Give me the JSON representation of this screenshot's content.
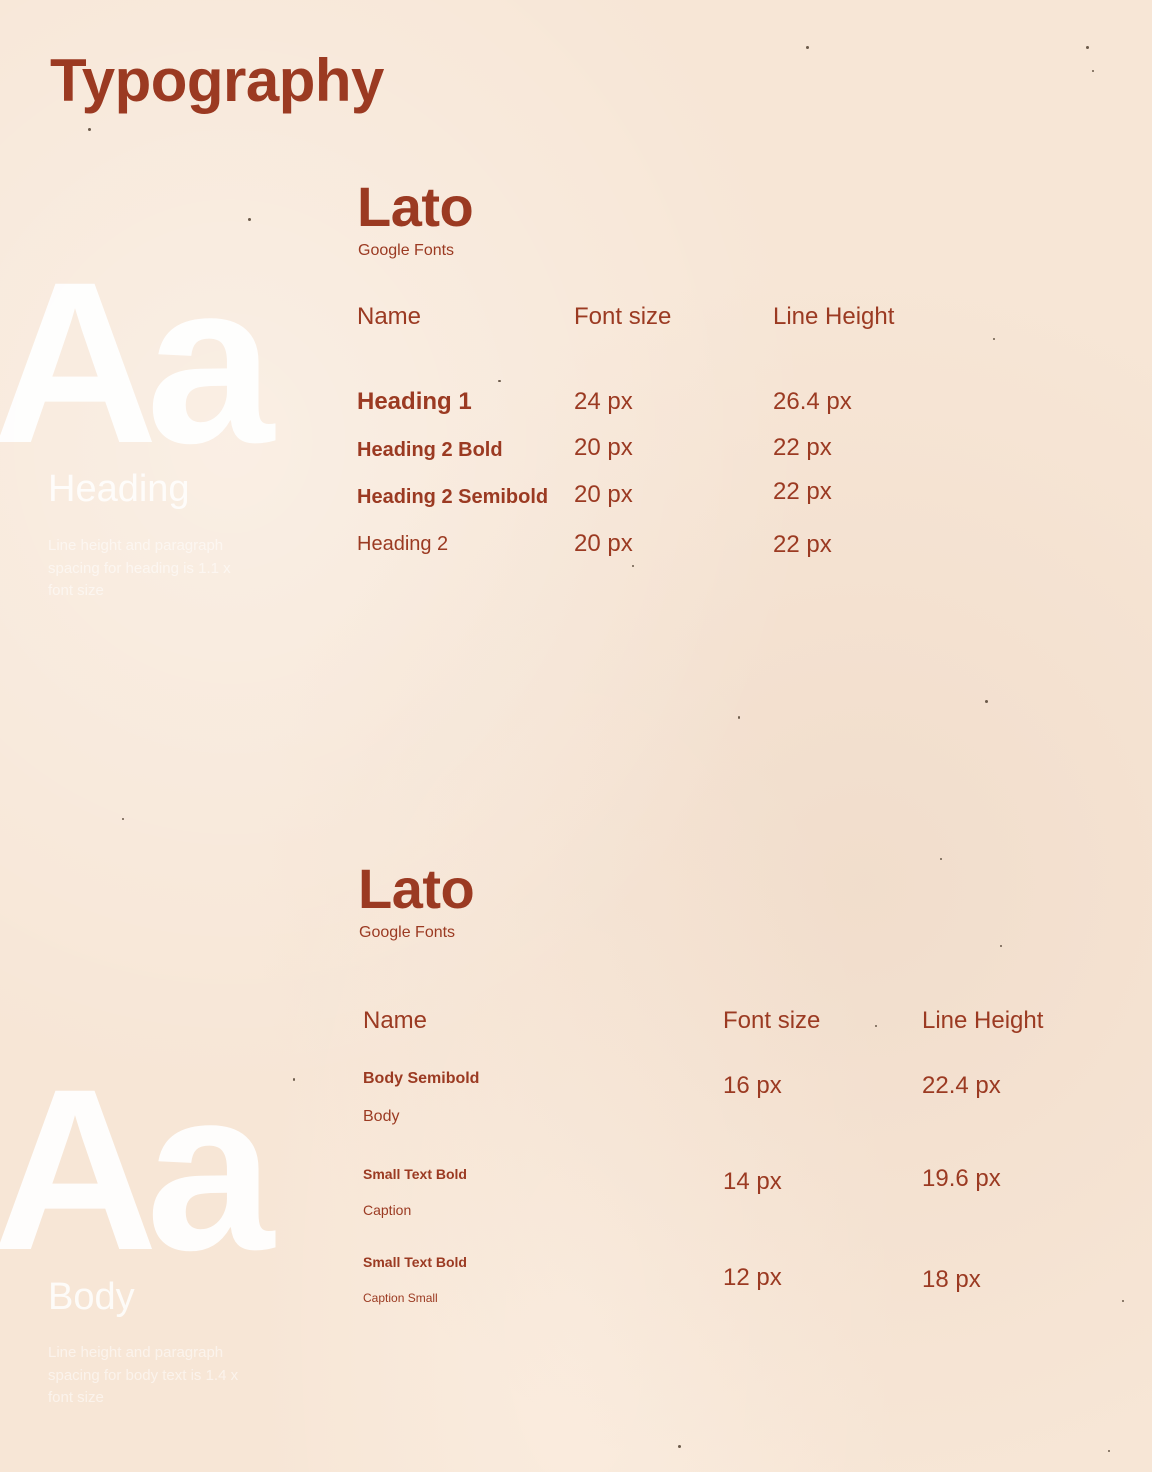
{
  "page": {
    "title": "Typography"
  },
  "colors": {
    "background": "#f7e6d6",
    "accent": "#9b3a22",
    "glyph": "#ffffff"
  },
  "heading_section": {
    "glyph": "Aa",
    "label": "Heading",
    "note": "Line height and paragraph spacing for heading is 1.1 x font size",
    "font": {
      "name": "Lato",
      "source": "Google Fonts"
    },
    "columns": [
      "Name",
      "Font size",
      "Line Height"
    ],
    "rows": [
      {
        "name": "Heading 1",
        "font_size": "24 px",
        "line_height": "26.4 px"
      },
      {
        "name": "Heading 2 Bold",
        "font_size": "20 px",
        "line_height": "22 px"
      },
      {
        "name": "Heading 2 Semibold",
        "font_size": "20 px",
        "line_height": "22 px"
      },
      {
        "name": "Heading 2",
        "font_size": "20 px",
        "line_height": "22 px"
      }
    ]
  },
  "body_section": {
    "glyph": "Aa",
    "label": "Body",
    "note": "Line height and paragraph spacing for body text is 1.4 x font size",
    "font": {
      "name": "Lato",
      "source": "Google Fonts"
    },
    "columns": [
      "Name",
      "Font size",
      "Line Height"
    ],
    "rows": [
      {
        "name_primary": "Body Semibold",
        "name_secondary": "Body",
        "font_size": "16 px",
        "line_height": "22.4 px"
      },
      {
        "name_primary": "Small Text Bold",
        "name_secondary": "Caption",
        "font_size": "14 px",
        "line_height": "19.6 px"
      },
      {
        "name_primary": "Small Text Bold",
        "name_secondary": "Caption Small",
        "font_size": "12 px",
        "line_height": "18 px"
      }
    ]
  }
}
